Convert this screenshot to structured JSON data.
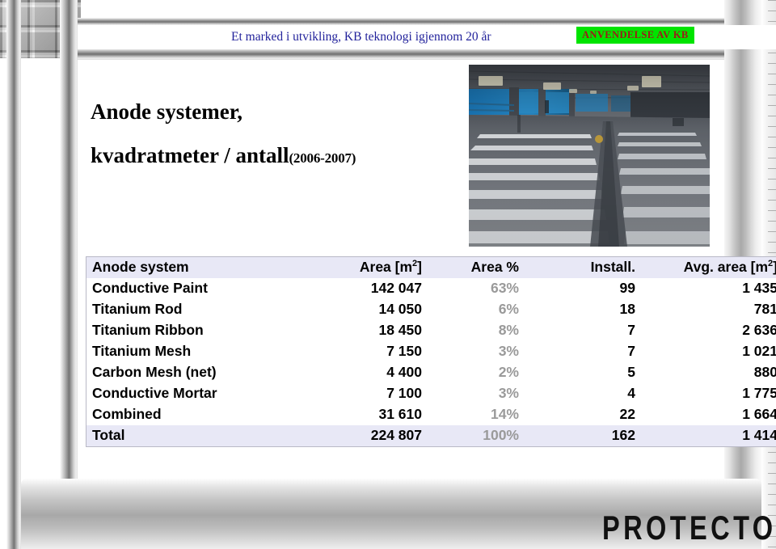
{
  "banner": {
    "title": "Et marked i utvikling, KB teknologi igjennom 20 år",
    "badge": "ANVENDELSE AV KB",
    "badge_bg": "#00e400",
    "badge_color": "#9e1a1a",
    "title_color": "#22229b"
  },
  "slide": {
    "title_line1": "Anode systemer,",
    "title_line2": "kvadratmeter / antall",
    "title_years": "(2006-2007)",
    "photo_alt": "underpass-floor-photo"
  },
  "footer": {
    "logo": "PROTECTOR"
  },
  "table": {
    "headers": {
      "name": "Anode system",
      "area": "Area [m",
      "area_sup": "2",
      "area_suffix": "]",
      "area_pct": "Area %",
      "install": "Install.",
      "avg": "Avg. area [m",
      "avg_sup": "2",
      "avg_suffix": "]"
    },
    "rows": [
      {
        "name": "Conductive Paint",
        "area": "142 047",
        "pct": "63%",
        "install": "99",
        "avg": "1 435"
      },
      {
        "name": "Titanium Rod",
        "area": "14 050",
        "pct": "6%",
        "install": "18",
        "avg": "781"
      },
      {
        "name": "Titanium Ribbon",
        "area": "18 450",
        "pct": "8%",
        "install": "7",
        "avg": "2 636"
      },
      {
        "name": "Titanium Mesh",
        "area": "7 150",
        "pct": "3%",
        "install": "7",
        "avg": "1 021"
      },
      {
        "name": "Carbon Mesh (net)",
        "area": "4 400",
        "pct": "2%",
        "install": "5",
        "avg": "880"
      },
      {
        "name": "Conductive Mortar",
        "area": "7 100",
        "pct": "3%",
        "install": "4",
        "avg": "1 775"
      },
      {
        "name": "Combined",
        "area": "31 610",
        "pct": "14%",
        "install": "22",
        "avg": "1 664"
      }
    ],
    "total": {
      "name": "Total",
      "area": "224 807",
      "pct": "100%",
      "install": "162",
      "avg": "1 414"
    },
    "header_bg": "#e8e8f6",
    "pct_color": "#9a9a9a"
  },
  "chart_data": {
    "type": "table",
    "title": "Anode systemer, kvadratmeter / antall (2006-2007)",
    "columns": [
      "Anode system",
      "Area [m2]",
      "Area %",
      "Install.",
      "Avg. area [m2]"
    ],
    "categories": [
      "Conductive Paint",
      "Titanium Rod",
      "Titanium Ribbon",
      "Titanium Mesh",
      "Carbon Mesh (net)",
      "Conductive Mortar",
      "Combined",
      "Total"
    ],
    "series": [
      {
        "name": "Area [m2]",
        "values": [
          142047,
          14050,
          18450,
          7150,
          4400,
          7100,
          31610,
          224807
        ]
      },
      {
        "name": "Area %",
        "values": [
          63,
          6,
          8,
          3,
          2,
          3,
          14,
          100
        ]
      },
      {
        "name": "Install.",
        "values": [
          99,
          18,
          7,
          7,
          5,
          4,
          22,
          162
        ]
      },
      {
        "name": "Avg. area [m2]",
        "values": [
          1435,
          781,
          2636,
          1021,
          880,
          1775,
          1664,
          1414
        ]
      }
    ]
  }
}
